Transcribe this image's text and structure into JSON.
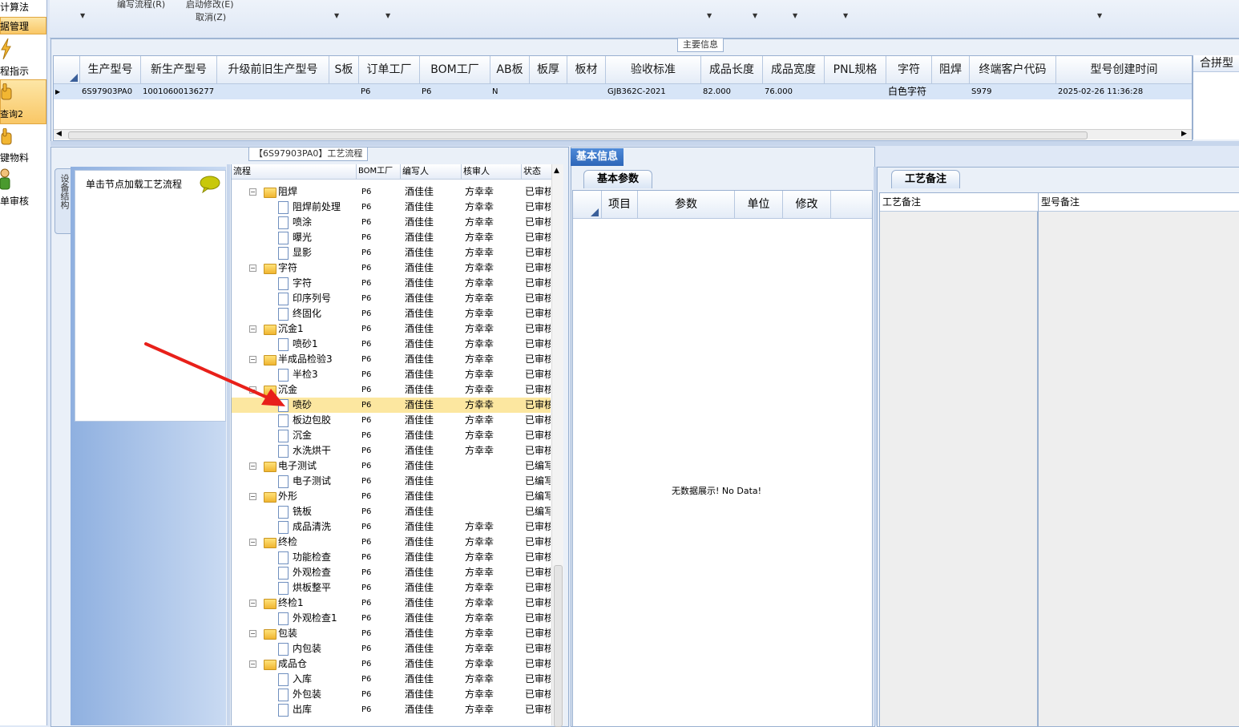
{
  "left_nav": {
    "items": [
      {
        "label": "计算法"
      },
      {
        "label": "据管理"
      },
      {
        "label": "程指示"
      },
      {
        "label": "查询2"
      },
      {
        "label": "键物料"
      },
      {
        "label": "单审核"
      }
    ]
  },
  "toolbar": {
    "items": [
      "编写流程(R)",
      "启动修改(E)",
      "取消(Z)"
    ]
  },
  "main_info": {
    "group_title": "主要信息",
    "columns": [
      "生产型号",
      "新生产型号",
      "升级前旧生产型号",
      "S板",
      "订单工厂",
      "BOM工厂",
      "AB板",
      "板厚",
      "板材",
      "验收标准",
      "成品长度",
      "成品宽度",
      "PNL规格",
      "字符",
      "阻焊",
      "终端客户代码",
      "型号创建时间"
    ],
    "row": {
      "生产型号": "6S97903PA0",
      "新生产型号": "10010600136277",
      "升级前旧生产型号": "",
      "S板": "",
      "订单工厂": "P6",
      "BOM工厂": "P6",
      "AB板": "N",
      "板厚": "",
      "板材": "",
      "验收标准": "GJB362C-2021",
      "成品长度": "82.000",
      "成品宽度": "76.000",
      "PNL规格": "",
      "字符": "白色字符",
      "阻焊": "",
      "终端客户代码": "S979",
      "型号创建时间": "2025-02-26 11:36:28"
    },
    "right_header": "合拼型"
  },
  "process": {
    "group_title": "【6S97903PA0】工艺流程",
    "side_tab": "设备结构",
    "load_hint": "单击节点加载工艺流程",
    "tree_columns": [
      "流程",
      "BOM工厂",
      "编写人",
      "核审人",
      "状态"
    ],
    "tree_rows": [
      {
        "level": 0,
        "type": "folder",
        "name": "阻焊",
        "bom": "P6",
        "writer": "酒佳佳",
        "reviewer": "方幸幸",
        "status": "已审核"
      },
      {
        "level": 1,
        "type": "doc",
        "name": "阻焊前处理",
        "bom": "P6",
        "writer": "酒佳佳",
        "reviewer": "方幸幸",
        "status": "已审核"
      },
      {
        "level": 1,
        "type": "doc",
        "name": "喷涂",
        "bom": "P6",
        "writer": "酒佳佳",
        "reviewer": "方幸幸",
        "status": "已审核"
      },
      {
        "level": 1,
        "type": "doc",
        "name": "曝光",
        "bom": "P6",
        "writer": "酒佳佳",
        "reviewer": "方幸幸",
        "status": "已审核"
      },
      {
        "level": 1,
        "type": "doc",
        "name": "显影",
        "bom": "P6",
        "writer": "酒佳佳",
        "reviewer": "方幸幸",
        "status": "已审核"
      },
      {
        "level": 0,
        "type": "folder",
        "name": "字符",
        "bom": "P6",
        "writer": "酒佳佳",
        "reviewer": "方幸幸",
        "status": "已审核"
      },
      {
        "level": 1,
        "type": "doc",
        "name": "字符",
        "bom": "P6",
        "writer": "酒佳佳",
        "reviewer": "方幸幸",
        "status": "已审核"
      },
      {
        "level": 1,
        "type": "doc",
        "name": "印序列号",
        "bom": "P6",
        "writer": "酒佳佳",
        "reviewer": "方幸幸",
        "status": "已审核"
      },
      {
        "level": 1,
        "type": "doc",
        "name": "终固化",
        "bom": "P6",
        "writer": "酒佳佳",
        "reviewer": "方幸幸",
        "status": "已审核"
      },
      {
        "level": 0,
        "type": "folder",
        "name": "沉金1",
        "bom": "P6",
        "writer": "酒佳佳",
        "reviewer": "方幸幸",
        "status": "已审核"
      },
      {
        "level": 1,
        "type": "doc",
        "name": "喷砂1",
        "bom": "P6",
        "writer": "酒佳佳",
        "reviewer": "方幸幸",
        "status": "已审核"
      },
      {
        "level": 0,
        "type": "folder",
        "name": "半成品检验3",
        "bom": "P6",
        "writer": "酒佳佳",
        "reviewer": "方幸幸",
        "status": "已审核"
      },
      {
        "level": 1,
        "type": "doc",
        "name": "半检3",
        "bom": "P6",
        "writer": "酒佳佳",
        "reviewer": "方幸幸",
        "status": "已审核"
      },
      {
        "level": 0,
        "type": "folder",
        "name": "沉金",
        "bom": "P6",
        "writer": "酒佳佳",
        "reviewer": "方幸幸",
        "status": "已审核"
      },
      {
        "level": 1,
        "type": "doc",
        "name": "喷砂",
        "bom": "P6",
        "writer": "酒佳佳",
        "reviewer": "方幸幸",
        "status": "已审核",
        "selected": true
      },
      {
        "level": 1,
        "type": "doc",
        "name": "板边包胶",
        "bom": "P6",
        "writer": "酒佳佳",
        "reviewer": "方幸幸",
        "status": "已审核"
      },
      {
        "level": 1,
        "type": "doc",
        "name": "沉金",
        "bom": "P6",
        "writer": "酒佳佳",
        "reviewer": "方幸幸",
        "status": "已审核"
      },
      {
        "level": 1,
        "type": "doc",
        "name": "水洗烘干",
        "bom": "P6",
        "writer": "酒佳佳",
        "reviewer": "方幸幸",
        "status": "已审核"
      },
      {
        "level": 0,
        "type": "folder",
        "name": "电子测试",
        "bom": "P6",
        "writer": "酒佳佳",
        "reviewer": "",
        "status": "已编写"
      },
      {
        "level": 1,
        "type": "doc",
        "name": "电子测试",
        "bom": "P6",
        "writer": "酒佳佳",
        "reviewer": "",
        "status": "已编写"
      },
      {
        "level": 0,
        "type": "folder",
        "name": "外形",
        "bom": "P6",
        "writer": "酒佳佳",
        "reviewer": "",
        "status": "已编写"
      },
      {
        "level": 1,
        "type": "doc",
        "name": "铣板",
        "bom": "P6",
        "writer": "酒佳佳",
        "reviewer": "",
        "status": "已编写"
      },
      {
        "level": 1,
        "type": "doc",
        "name": "成品清洗",
        "bom": "P6",
        "writer": "酒佳佳",
        "reviewer": "方幸幸",
        "status": "已审核"
      },
      {
        "level": 0,
        "type": "folder",
        "name": "终检",
        "bom": "P6",
        "writer": "酒佳佳",
        "reviewer": "方幸幸",
        "status": "已审核"
      },
      {
        "level": 1,
        "type": "doc",
        "name": "功能检查",
        "bom": "P6",
        "writer": "酒佳佳",
        "reviewer": "方幸幸",
        "status": "已审核"
      },
      {
        "level": 1,
        "type": "doc",
        "name": "外观检查",
        "bom": "P6",
        "writer": "酒佳佳",
        "reviewer": "方幸幸",
        "status": "已审核"
      },
      {
        "level": 1,
        "type": "doc",
        "name": "烘板整平",
        "bom": "P6",
        "writer": "酒佳佳",
        "reviewer": "方幸幸",
        "status": "已审核"
      },
      {
        "level": 0,
        "type": "folder",
        "name": "终检1",
        "bom": "P6",
        "writer": "酒佳佳",
        "reviewer": "方幸幸",
        "status": "已审核"
      },
      {
        "level": 1,
        "type": "doc",
        "name": "外观检查1",
        "bom": "P6",
        "writer": "酒佳佳",
        "reviewer": "方幸幸",
        "status": "已审核"
      },
      {
        "level": 0,
        "type": "folder",
        "name": "包装",
        "bom": "P6",
        "writer": "酒佳佳",
        "reviewer": "方幸幸",
        "status": "已审核"
      },
      {
        "level": 1,
        "type": "doc",
        "name": "内包装",
        "bom": "P6",
        "writer": "酒佳佳",
        "reviewer": "方幸幸",
        "status": "已审核"
      },
      {
        "level": 0,
        "type": "folder",
        "name": "成品仓",
        "bom": "P6",
        "writer": "酒佳佳",
        "reviewer": "方幸幸",
        "status": "已审核"
      },
      {
        "level": 1,
        "type": "doc",
        "name": "入库",
        "bom": "P6",
        "writer": "酒佳佳",
        "reviewer": "方幸幸",
        "status": "已审核"
      },
      {
        "level": 1,
        "type": "doc",
        "name": "外包装",
        "bom": "P6",
        "writer": "酒佳佳",
        "reviewer": "方幸幸",
        "status": "已审核"
      },
      {
        "level": 1,
        "type": "doc",
        "name": "出库",
        "bom": "P6",
        "writer": "酒佳佳",
        "reviewer": "方幸幸",
        "status": "已审核"
      }
    ]
  },
  "basic_info": {
    "tab_label": "基本信息",
    "subtab_label": "基本参数",
    "columns": [
      "项目",
      "参数",
      "单位",
      "修改"
    ],
    "empty_text": "无数据展示! No Data!"
  },
  "process_notes": {
    "tab_label": "工艺备注",
    "left_header": "工艺备注",
    "right_header": "型号备注"
  },
  "colors": {
    "selection": "#fce7a0",
    "row_highlight": "#d7e5f7",
    "tab_blue": "#2d66b8",
    "arrow_red": "#e8201a"
  }
}
